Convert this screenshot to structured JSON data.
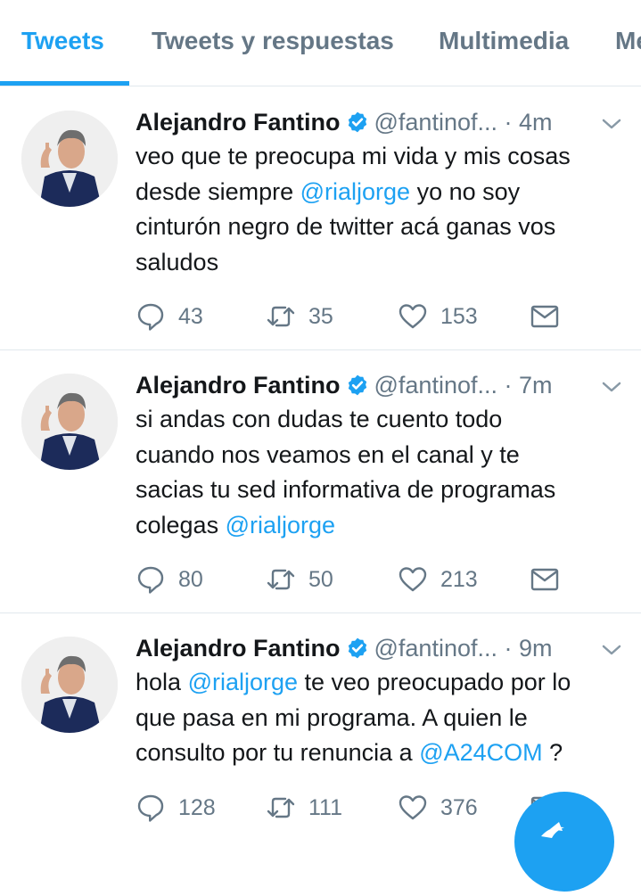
{
  "tabs": [
    "Tweets",
    "Tweets y respuestas",
    "Multimedia",
    "Me"
  ],
  "colors": {
    "accent": "#1da1f2",
    "muted": "#657786",
    "text": "#14171a"
  },
  "tweets": [
    {
      "name": "Alejandro Fantino",
      "handle": "@fantinof...",
      "time": "· 4m",
      "text_parts": [
        "veo que te preocupa mi vida y mis cosas\ndesde siempre ",
        "@rialjorge",
        " yo no soy\ncinturón negro de twitter acá ganas vos\nsaludos"
      ],
      "replies": "43",
      "retweets": "35",
      "likes": "153"
    },
    {
      "name": "Alejandro Fantino",
      "handle": "@fantinof...",
      "time": "· 7m",
      "text_parts": [
        "si andas con dudas te cuento todo\ncuando nos veamos en el canal y te\nsacias tu sed informativa de programas\ncolegas ",
        "@rialjorge",
        ""
      ],
      "replies": "80",
      "retweets": "50",
      "likes": "213"
    },
    {
      "name": "Alejandro Fantino",
      "handle": "@fantinof...",
      "time": "· 9m",
      "text_parts": [
        "hola ",
        "@rialjorge",
        " te veo preocupado por lo\nque pasa en mi programa.  A quien le\nconsulto por tu renuncia a ",
        "@A24COM",
        " ?"
      ],
      "replies": "128",
      "retweets": "111",
      "likes": "376"
    }
  ],
  "icons": [
    "verified-badge-icon",
    "chevron-down-icon",
    "reply-icon",
    "retweet-icon",
    "like-icon",
    "direct-message-icon",
    "compose-tweet-icon"
  ]
}
